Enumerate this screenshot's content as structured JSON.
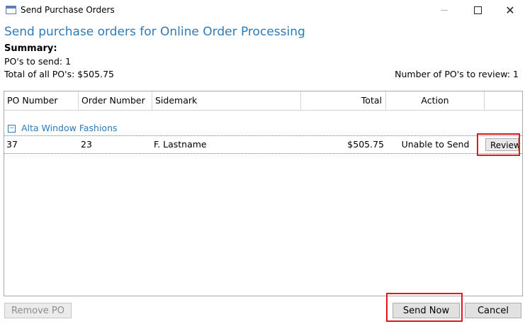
{
  "window": {
    "title": "Send Purchase Orders",
    "icon": "window-app-icon"
  },
  "heading": "Send purchase orders for Online Order Processing",
  "summary": {
    "label": "Summary:",
    "po_to_send": "PO's to send: 1",
    "total_all": "Total of all PO's: $505.75",
    "review_label": "Number of PO's to review:",
    "review_count": "1"
  },
  "grid": {
    "columns": [
      "PO Number",
      "Order Number",
      "Sidemark",
      "Total",
      "Action"
    ],
    "group": "Alta Window Fashions",
    "rows": [
      {
        "po_number": "37",
        "order_number": "23",
        "sidemark": "F. Lastname",
        "total": "$505.75",
        "action": "Unable to Send",
        "button": "Review"
      }
    ]
  },
  "buttons": {
    "remove_po": "Remove PO",
    "send_now": "Send Now",
    "cancel": "Cancel"
  },
  "colors": {
    "heading": "#2e7ab8",
    "highlight": "#e0181e"
  }
}
